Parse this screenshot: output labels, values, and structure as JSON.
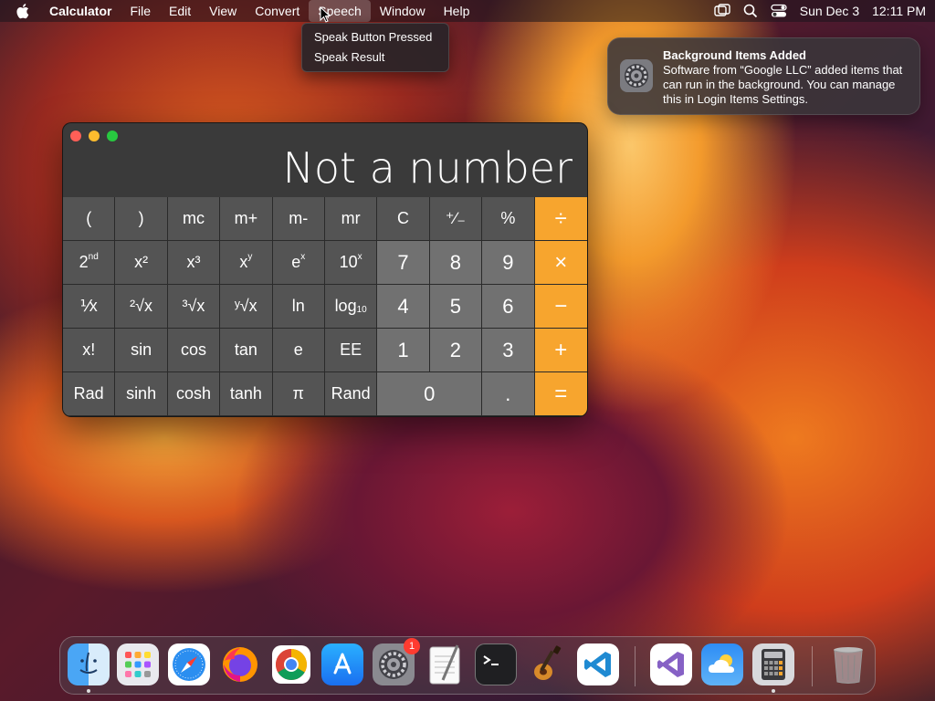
{
  "menubar": {
    "app_name": "Calculator",
    "items": [
      "File",
      "Edit",
      "View",
      "Convert",
      "Speech",
      "Window",
      "Help"
    ],
    "active_item": "Speech",
    "date": "Sun Dec 3",
    "time": "12:11 PM"
  },
  "speech_menu": {
    "items": [
      "Speak Button Pressed",
      "Speak Result"
    ]
  },
  "notification": {
    "title": "Background Items Added",
    "body": "Software from “Google LLC” added items that can run in the background. You can manage this in Login Items Settings."
  },
  "calculator": {
    "display": "Not a number",
    "keys": {
      "lparen": "(",
      "rparen": ")",
      "mc": "mc",
      "mplus": "m+",
      "mminus": "m-",
      "mr": "mr",
      "clear": "C",
      "sign": "⁺∕₋",
      "percent": "%",
      "divide": "÷",
      "second": "2",
      "second_sup": "nd",
      "x2": "x²",
      "x3": "x³",
      "xy": "x",
      "xy_sup": "y",
      "ex": "e",
      "ex_sup": "x",
      "tenx": "10",
      "tenx_sup": "x",
      "seven": "7",
      "eight": "8",
      "nine": "9",
      "multiply": "×",
      "recip": "⅟x",
      "sqrt2": "²√x",
      "sqrt3": "³√x",
      "sqrty": "ʸ√x",
      "ln": "ln",
      "log": "log",
      "log_sub": "10",
      "four": "4",
      "five": "5",
      "six": "6",
      "minus": "−",
      "fact": "x!",
      "sin": "sin",
      "cos": "cos",
      "tan": "tan",
      "e": "e",
      "ee": "EE",
      "one": "1",
      "two": "2",
      "three": "3",
      "plus": "+",
      "rad": "Rad",
      "sinh": "sinh",
      "cosh": "cosh",
      "tanh": "tanh",
      "pi": "π",
      "rand": "Rand",
      "zero": "0",
      "dot": ".",
      "equals": "="
    }
  },
  "dock": {
    "apps": [
      "Finder",
      "Launchpad",
      "Safari",
      "Firefox",
      "Google Chrome",
      "App Store",
      "System Settings",
      "TextEdit",
      "Terminal",
      "GarageBand",
      "Visual Studio Code",
      "Visual Studio",
      "Weather",
      "Calculator",
      "Trash"
    ],
    "system_settings_badge": "1"
  },
  "colors": {
    "operator": "#f7a52e",
    "function_key": "#545454",
    "number_key": "#717171",
    "calculator_bg": "#3a3a3a"
  }
}
